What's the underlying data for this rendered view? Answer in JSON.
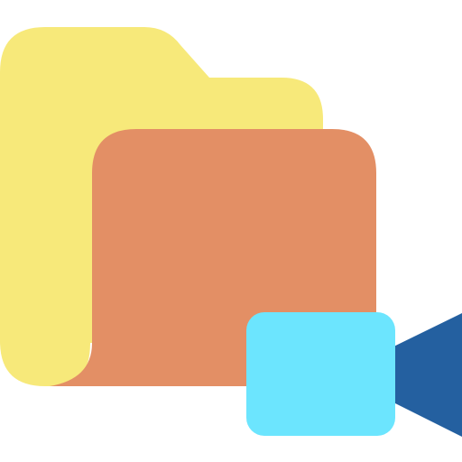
{
  "icon": {
    "name": "video-folder-icon",
    "parts": {
      "folder_back": {
        "name": "folder-back-icon",
        "color": "#F7E97A"
      },
      "folder_front": {
        "name": "folder-front-icon",
        "color": "#E38F65"
      },
      "camera_body": {
        "name": "video-camera-body-icon",
        "color": "#6CE5FE"
      },
      "camera_lens": {
        "name": "video-camera-lens-icon",
        "color": "#2460A0"
      }
    }
  }
}
